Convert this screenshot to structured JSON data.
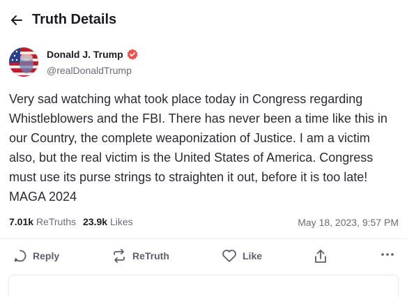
{
  "header": {
    "title": "Truth Details",
    "back_icon": "arrow-left-icon"
  },
  "author": {
    "name": "Donald J. Trump",
    "handle": "@realDonaldTrump",
    "verified_icon": "verified-badge-icon",
    "verified_color": "#e8524f"
  },
  "post": {
    "text": "Very sad watching what took place today in Congress regarding Whistleblowers and the FBI. There has never been a time like this in our Country, the complete weaponization of Justice. I am a victim also, but the real victim is the United States of America. Congress must use its purse strings to straighten it out, before it is too late! MAGA 2024"
  },
  "stats": {
    "retruths_count": "7.01k",
    "retruths_label": "ReTruths",
    "likes_count": "23.9k",
    "likes_label": "Likes",
    "timestamp": "May 18, 2023, 9:57 PM"
  },
  "actions": {
    "reply_label": "Reply",
    "retruth_label": "ReTruth",
    "like_label": "Like",
    "share_icon": "share-icon",
    "more_icon": "more-dots-icon"
  }
}
